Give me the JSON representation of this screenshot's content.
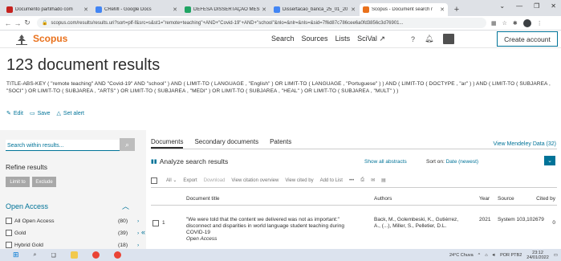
{
  "browser": {
    "tabs": [
      {
        "label": "Documento partilhado com",
        "color": "#c5221f",
        "active": false
      },
      {
        "label": "CReMI - Google Docs",
        "color": "#4285f4",
        "active": false
      },
      {
        "label": "DEFESA DISSERTAÇÃO MEST",
        "color": "#1fa463",
        "active": false
      },
      {
        "label": "Dissertacao_banca_25_01_20",
        "color": "#4285f4",
        "active": false
      },
      {
        "label": "Scopus - Document search r",
        "color": "#e9711c",
        "active": true
      }
    ],
    "url": "scopus.com/results/results.uri?sort=plf-f&src=s&st1=\"remote+teaching\"+AND+\"Covid-19\"+AND+\"school\"&nlo=&nlr=&nls=&sid=7f6d87c786cee6a0fd3856c3d76901..."
  },
  "header": {
    "brand": "Scopus",
    "nav": [
      "Search",
      "Sources",
      "Lists",
      "SciVal"
    ],
    "scival_arrow": "↗",
    "create_account": "Create account"
  },
  "results_title": "123 document results",
  "query_text": "TITLE-ABS-KEY ( \"remote teaching\" AND \"Covid-19\" AND \"school\" ) AND ( LIMIT-TO ( LANGUAGE , \"English\" ) OR LIMIT-TO ( LANGUAGE , \"Portuguese\" ) ) AND ( LIMIT-TO ( DOCTYPE , \"ar\" ) ) AND ( LIMIT-TO ( SUBJAREA , \"SOCI\" ) OR LIMIT-TO ( SUBJAREA , \"ARTS\" ) OR LIMIT-TO ( SUBJAREA , \"MEDI\" ) OR LIMIT-TO ( SUBJAREA , \"HEAL\" ) OR LIMIT-TO ( SUBJAREA , \"MULT\" ) )",
  "query_actions": {
    "edit": "Edit",
    "save": "Save",
    "alert": "Set alert"
  },
  "sidebar": {
    "search_placeholder": "Search within results...",
    "refine": "Refine results",
    "limit_to": "Limit to",
    "exclude": "Exclude",
    "open_access_header": "Open Access",
    "facets": [
      {
        "label": "All Open Access",
        "count": "(80)"
      },
      {
        "label": "Gold",
        "count": "(39)"
      },
      {
        "label": "Hybrid Gold",
        "count": "(18)"
      }
    ]
  },
  "main": {
    "tabs": [
      "Documents",
      "Secondary documents",
      "Patents"
    ],
    "mendeley": "View Mendeley Data (32)",
    "analyze": "Analyze search results",
    "show_abstracts": "Show all abstracts",
    "sort_label": "Sort on:",
    "sort_value": "Date (newest)",
    "toolbar": [
      "All",
      "Export",
      "Download",
      "View citation overview",
      "View cited by",
      "Add to List",
      "•••"
    ],
    "columns": {
      "title": "Document title",
      "authors": "Authors",
      "year": "Year",
      "source": "Source",
      "cited": "Cited by"
    },
    "rows": [
      {
        "num": "1",
        "title": "\"We were told that the content we delivered was not as important:\" disconnect and disparities in world language student teaching during COVID-19",
        "access": "Open Access",
        "authors": "Back, M., Golembeski, K., Gutiérrez, A., (...), Miller, S., Pelletier, D.L.",
        "year": "2021",
        "source": "System 103,102679",
        "cited": "0"
      }
    ]
  },
  "taskbar": {
    "weather": "24°C Chuva",
    "lang": "POR PTB2",
    "time": "23:12",
    "date": "24/01/2022"
  }
}
